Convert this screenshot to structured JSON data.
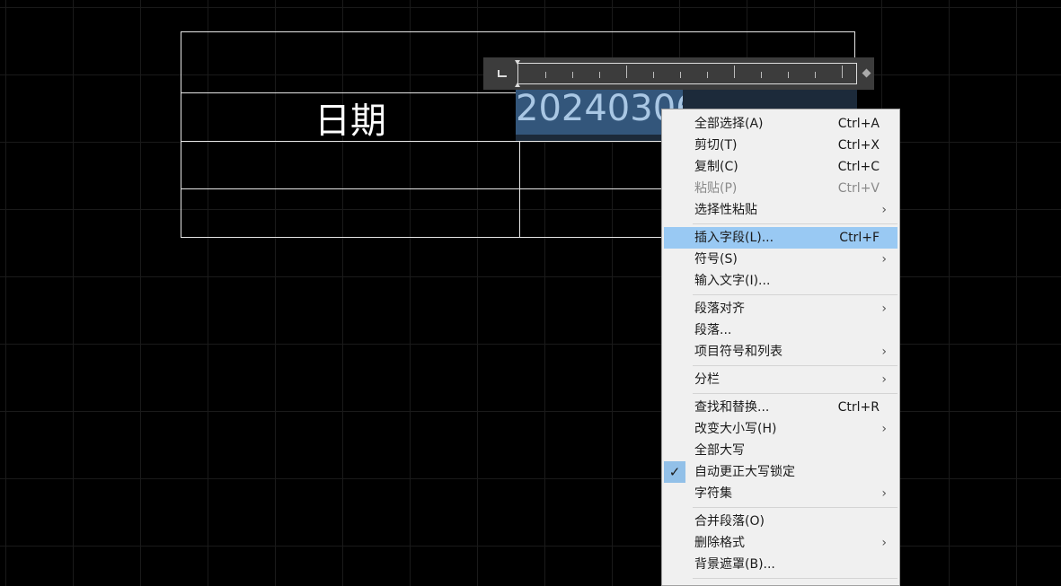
{
  "table": {
    "date_label": "日期"
  },
  "editor": {
    "selected_text": "20240306"
  },
  "context_menu": {
    "items": [
      {
        "label": "全部选择(A)",
        "shortcut": "Ctrl+A"
      },
      {
        "label": "剪切(T)",
        "shortcut": "Ctrl+X"
      },
      {
        "label": "复制(C)",
        "shortcut": "Ctrl+C"
      },
      {
        "label": "粘贴(P)",
        "shortcut": "Ctrl+V",
        "disabled": true
      },
      {
        "label": "选择性粘贴",
        "submenu": true
      },
      {
        "separator": true
      },
      {
        "label": "插入字段(L)...",
        "shortcut": "Ctrl+F",
        "highlighted": true
      },
      {
        "label": "符号(S)",
        "submenu": true
      },
      {
        "label": "输入文字(I)..."
      },
      {
        "separator": true
      },
      {
        "label": "段落对齐",
        "submenu": true
      },
      {
        "label": "段落..."
      },
      {
        "label": "项目符号和列表",
        "submenu": true
      },
      {
        "separator": true
      },
      {
        "label": "分栏",
        "submenu": true
      },
      {
        "separator": true
      },
      {
        "label": "查找和替换...",
        "shortcut": "Ctrl+R"
      },
      {
        "label": "改变大小写(H)",
        "submenu": true
      },
      {
        "label": "全部大写"
      },
      {
        "label": "自动更正大写锁定",
        "checked": true
      },
      {
        "label": "字符集",
        "submenu": true
      },
      {
        "separator": true
      },
      {
        "label": "合并段落(O)"
      },
      {
        "label": "删除格式",
        "submenu": true
      },
      {
        "label": "背景遮罩(B)..."
      },
      {
        "separator": true
      }
    ],
    "submenu_arrow": "›",
    "check_glyph": "✓"
  }
}
